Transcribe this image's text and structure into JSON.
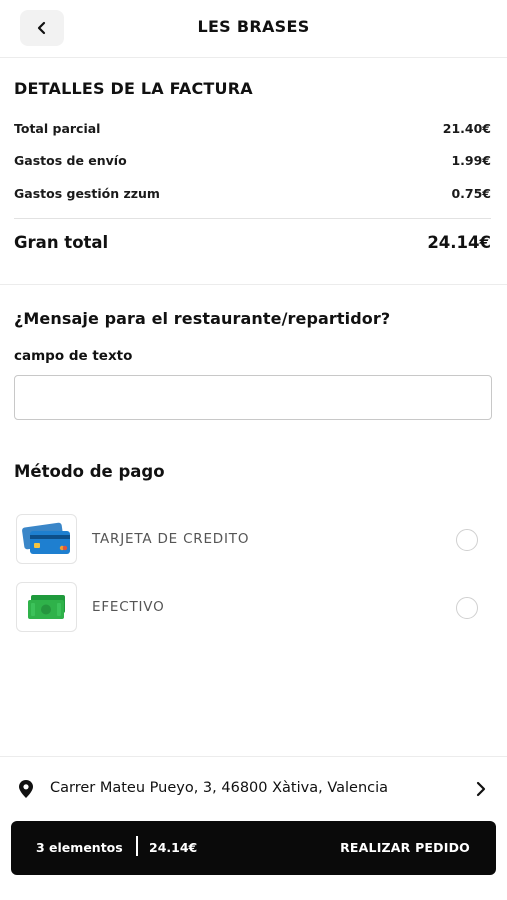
{
  "header": {
    "title": "LES BRASES",
    "back_icon": "chevron-left-icon"
  },
  "invoice": {
    "title": "DETALLES DE LA FACTURA",
    "rows": [
      {
        "label": "Total parcial",
        "value": "21.40€"
      },
      {
        "label": "Gastos de envío",
        "value": "1.99€"
      },
      {
        "label": "Gastos gestión zzum",
        "value": "0.75€"
      }
    ],
    "total_label": "Gran total",
    "total_value": "24.14€"
  },
  "message": {
    "title": "¿Mensaje para el restaurante/repartidor?",
    "field_label": "campo de texto",
    "value": "",
    "placeholder": ""
  },
  "payment": {
    "title": "Método de pago",
    "options": [
      {
        "label": "TARJETA DE CREDITO",
        "icon": "credit-card-icon",
        "selected": false
      },
      {
        "label": "EFECTIVO",
        "icon": "cash-icon",
        "selected": false
      }
    ]
  },
  "address": {
    "text": "Carrer Mateu Pueyo, 3, 46800 Xàtiva, Valencia",
    "icon": "location-pin-icon"
  },
  "order_bar": {
    "items": "3 elementos",
    "total": "24.14€",
    "action": "REALIZAR PEDIDO"
  },
  "colors": {
    "order_bar_bg": "#0a0a0a",
    "card_blue": "#1e7fd0",
    "cash_green": "#2fb24a"
  }
}
